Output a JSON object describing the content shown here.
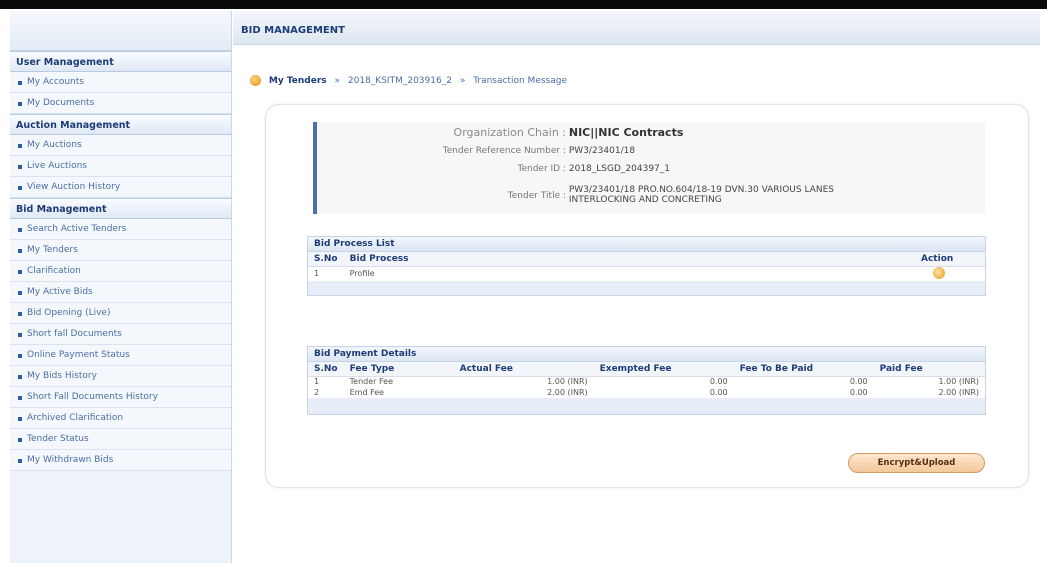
{
  "sidebar": {
    "sections": [
      {
        "header": "User Management",
        "items": [
          "My Accounts",
          "My Documents"
        ]
      },
      {
        "header": "Auction Management",
        "items": [
          "My Auctions",
          "Live Auctions",
          "View Auction History"
        ]
      },
      {
        "header": "Bid Management",
        "items": [
          "Search Active Tenders",
          "My Tenders",
          "Clarification",
          "My Active Bids",
          "Bid Opening (Live)",
          "Short fall Documents",
          "Online Payment Status",
          "My Bids History",
          "Short Fall Documents History",
          "Archived Clarification",
          "Tender Status",
          "My Withdrawn Bids"
        ]
      }
    ]
  },
  "main": {
    "title": "BID MANAGEMENT",
    "breadcrumb": [
      "My Tenders",
      "2018_KSITM_203916_2",
      "Transaction Message"
    ],
    "breadcrumb_sep": "»"
  },
  "tender_info": {
    "org_chain_label": "Organization Chain :",
    "org_chain": "NIC||NIC Contracts",
    "ref_label": "Tender Reference Number :",
    "ref": "PW3/23401/18",
    "id_label": "Tender ID :",
    "id": "2018_LSGD_204397_1",
    "title_label": "Tender Title :",
    "title_line1": "PW3/23401/18 PRO.NO.604/18-19 DVN.30 VARIOUS LANES",
    "title_line2": "INTERLOCKING AND CONCRETING"
  },
  "bid_process": {
    "title": "Bid Process List",
    "columns": [
      "S.No",
      "Bid Process",
      "Action"
    ],
    "rows": [
      {
        "sno": "1",
        "process": "Profile"
      }
    ]
  },
  "payment": {
    "title": "Bid Payment Details",
    "columns": [
      "S.No",
      "Fee Type",
      "Actual Fee",
      "Exempted Fee",
      "Fee To Be Paid",
      "Paid Fee"
    ],
    "rows": [
      {
        "sno": "1",
        "type": "Tender Fee",
        "actual": "1.00 (INR)",
        "exempted": "0.00",
        "to_pay": "0.00",
        "paid": "1.00 (INR)"
      },
      {
        "sno": "2",
        "type": "Emd Fee",
        "actual": "2.00 (INR)",
        "exempted": "0.00",
        "to_pay": "0.00",
        "paid": "2.00 (INR)"
      }
    ]
  },
  "button": {
    "label": "Encrypt&Upload"
  },
  "icons": {
    "breadcrumb": "home-icon",
    "action": "edit-icon"
  },
  "colors": {
    "header_text": "#1d3c78",
    "link": "#4a6fa5",
    "accent": "#4c6fa8",
    "button": "#f4c79c"
  }
}
